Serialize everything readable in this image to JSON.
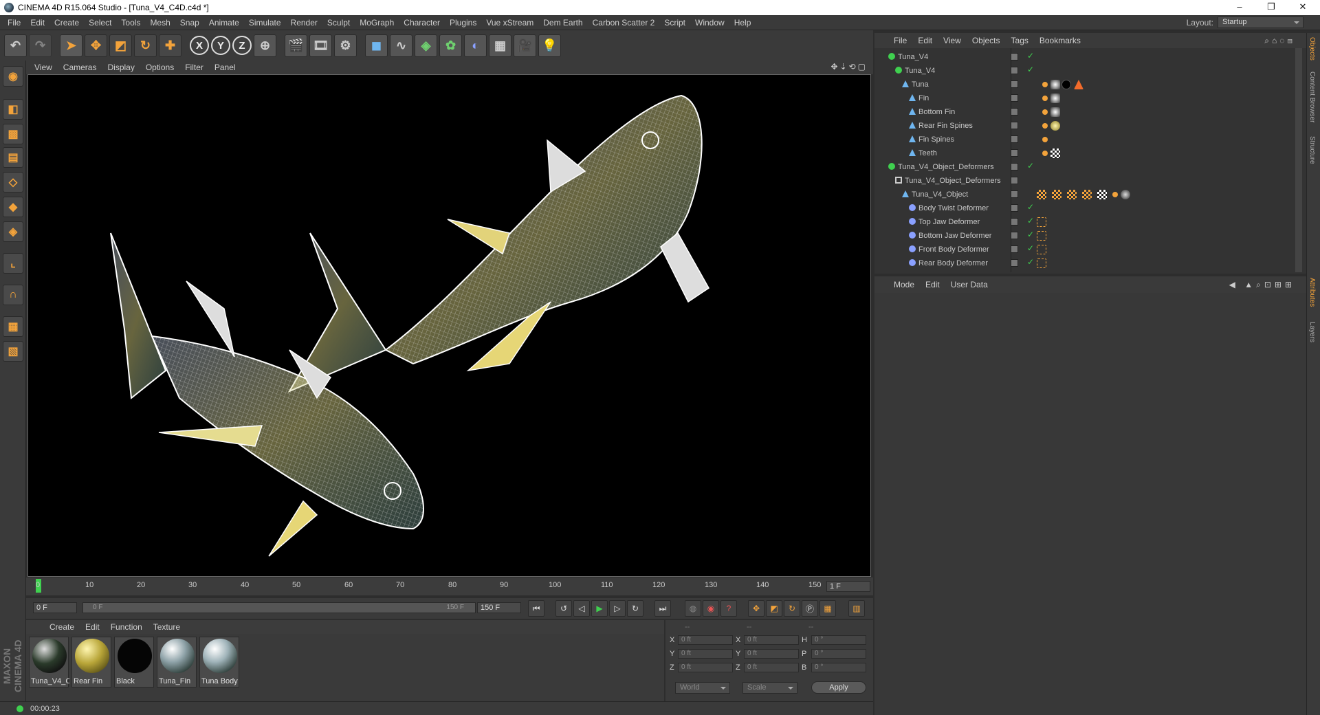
{
  "window": {
    "title": "CINEMA 4D R15.064 Studio - [Tuna_V4_C4D.c4d *]"
  },
  "menubar": {
    "items": [
      "File",
      "Edit",
      "Create",
      "Select",
      "Tools",
      "Mesh",
      "Snap",
      "Animate",
      "Simulate",
      "Render",
      "Sculpt",
      "MoGraph",
      "Character",
      "Plugins",
      "Vue xStream",
      "Dem Earth",
      "Carbon Scatter 2",
      "Script",
      "Window",
      "Help"
    ],
    "layout_label": "Layout:",
    "layout_value": "Startup"
  },
  "toolbar": {
    "axis_x": "X",
    "axis_y": "Y",
    "axis_z": "Z"
  },
  "viewport_menu": {
    "items": [
      "View",
      "Cameras",
      "Display",
      "Options",
      "Filter",
      "Panel"
    ]
  },
  "timeline": {
    "ticks": [
      "0",
      "10",
      "20",
      "30",
      "40",
      "50",
      "60",
      "70",
      "80",
      "90",
      "100",
      "110",
      "120",
      "130",
      "140",
      "150"
    ],
    "current_frame_box": "1 F"
  },
  "playbar": {
    "start_field": "0 F",
    "range_start": "0 F",
    "range_end": "150 F",
    "end_field": "150 F"
  },
  "material_manager": {
    "menu": [
      "Create",
      "Edit",
      "Function",
      "Texture"
    ],
    "materials": [
      {
        "name": "Tuna_V4_O",
        "color": "#2a3a2a"
      },
      {
        "name": "Rear Fin",
        "color": "#b8a538"
      },
      {
        "name": "Black",
        "color": "#050505"
      },
      {
        "name": "Tuna_Fin",
        "color": "#8fa3a9"
      },
      {
        "name": "Tuna Body",
        "color": "#9fb3b9"
      }
    ]
  },
  "coordinates": {
    "headers": [
      "--",
      "--",
      "--"
    ],
    "rows": [
      {
        "a": "X",
        "av": "0 ft",
        "b": "X",
        "bv": "0 ft",
        "c": "H",
        "cv": "0 °"
      },
      {
        "a": "Y",
        "av": "0 ft",
        "b": "Y",
        "bv": "0 ft",
        "c": "P",
        "cv": "0 °"
      },
      {
        "a": "Z",
        "av": "0 ft",
        "b": "Z",
        "bv": "0 ft",
        "c": "B",
        "cv": "0 °"
      }
    ],
    "space": "World",
    "mode": "Scale",
    "apply": "Apply"
  },
  "status": {
    "time": "00:00:23"
  },
  "object_manager": {
    "menu": [
      "File",
      "Edit",
      "View",
      "Objects",
      "Tags",
      "Bookmarks"
    ],
    "objects": [
      {
        "name": "Tuna_V4",
        "indent": 0,
        "check": "✓"
      },
      {
        "name": "Tuna_V4",
        "indent": 1,
        "check": "✓"
      },
      {
        "name": "Tuna",
        "indent": 2,
        "check": ""
      },
      {
        "name": "Fin",
        "indent": 3,
        "check": ""
      },
      {
        "name": "Bottom Fin",
        "indent": 3,
        "check": ""
      },
      {
        "name": "Rear Fin Spines",
        "indent": 3,
        "check": ""
      },
      {
        "name": "Fin Spines",
        "indent": 3,
        "check": ""
      },
      {
        "name": "Teeth",
        "indent": 3,
        "check": ""
      },
      {
        "name": "Tuna_V4_Object_Deformers",
        "indent": 0,
        "check": "✓"
      },
      {
        "name": "Tuna_V4_Object_Deformers",
        "indent": 1,
        "check": ""
      },
      {
        "name": "Tuna_V4_Object",
        "indent": 2,
        "check": ""
      },
      {
        "name": "Body Twist Deformer",
        "indent": 3,
        "check": "✓"
      },
      {
        "name": "Top Jaw Deformer",
        "indent": 3,
        "check": "✓"
      },
      {
        "name": "Bottom Jaw Deformer",
        "indent": 3,
        "check": "✓"
      },
      {
        "name": "Front Body Deformer",
        "indent": 3,
        "check": "✓"
      },
      {
        "name": "Rear Body Deformer",
        "indent": 3,
        "check": "✓"
      }
    ]
  },
  "attributes": {
    "menu": [
      "Mode",
      "Edit",
      "User Data"
    ]
  },
  "right_tabs": [
    "Objects",
    "Content Browser",
    "Structure",
    "Attributes",
    "Layers"
  ],
  "logo": {
    "text": "MAXON CINEMA 4D"
  }
}
